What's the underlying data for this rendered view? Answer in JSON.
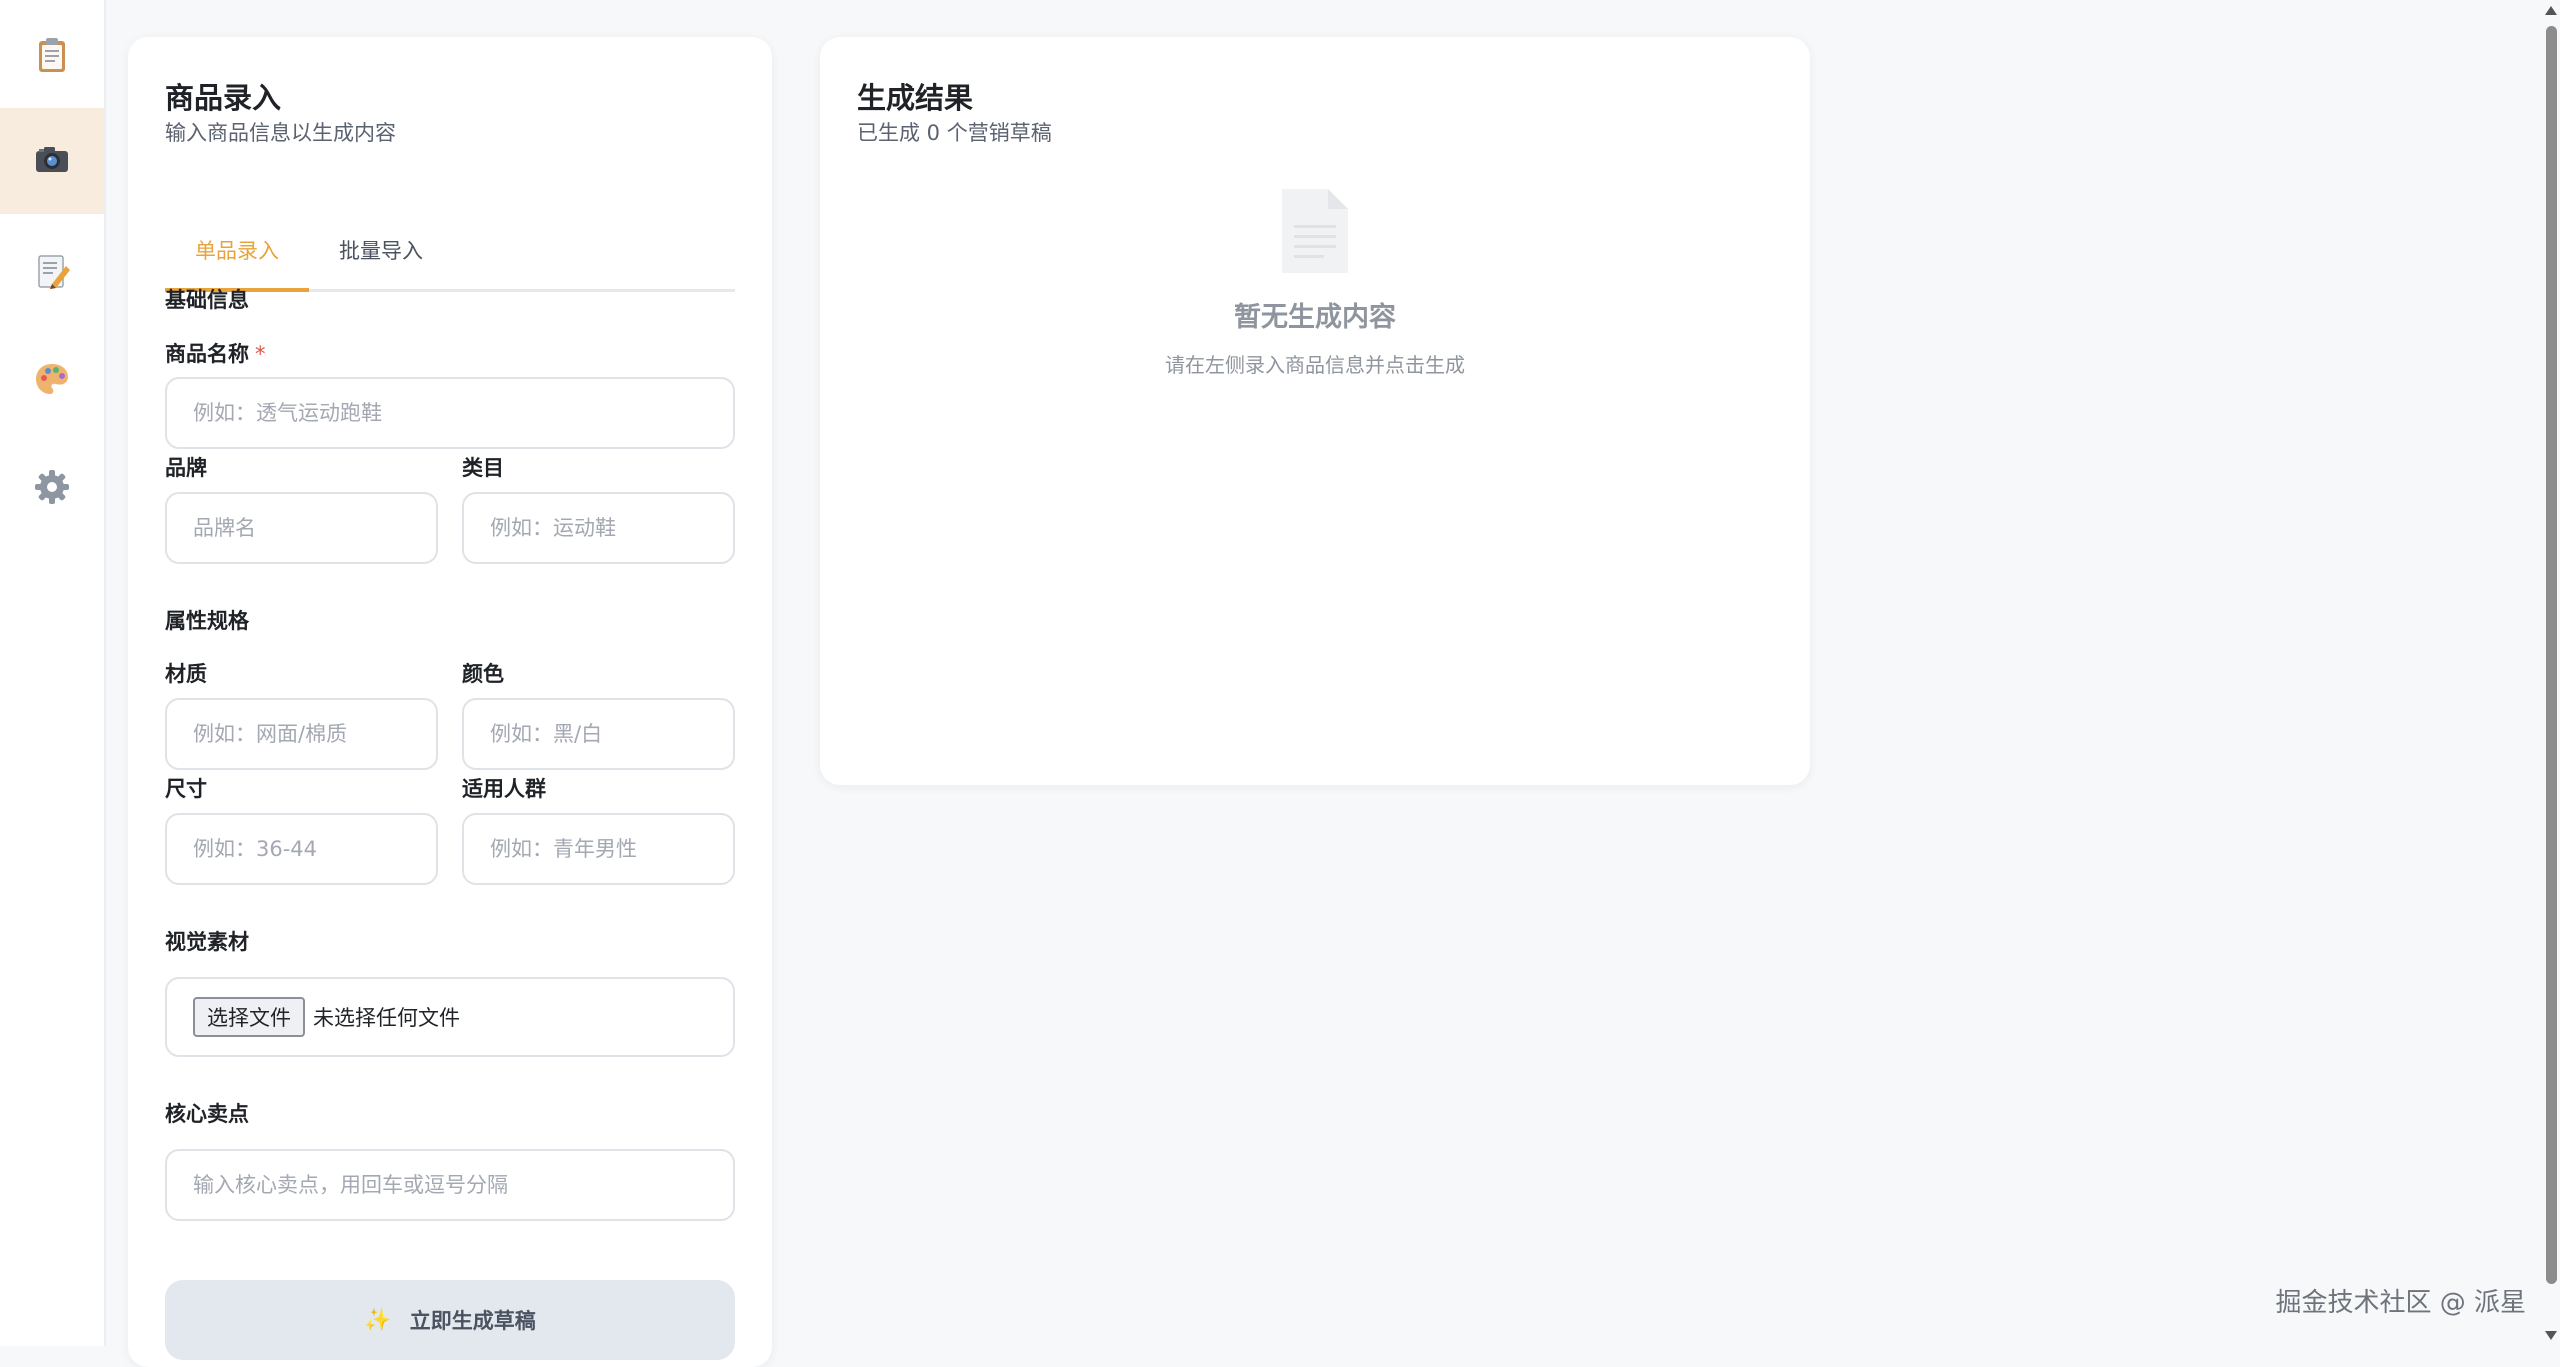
{
  "sidebar": {
    "items": [
      {
        "icon": "clipboard-icon",
        "active": false
      },
      {
        "icon": "camera-icon",
        "active": true
      },
      {
        "icon": "memo-icon",
        "active": false
      },
      {
        "icon": "palette-icon",
        "active": false
      },
      {
        "icon": "gear-icon",
        "active": false
      }
    ]
  },
  "left": {
    "title": "商品录入",
    "subtitle": "输入商品信息以生成内容",
    "tabs": [
      "单品录入",
      "批量导入"
    ],
    "section_basic": "基础信息",
    "section_attrs": "属性规格",
    "section_visual": "视觉素材",
    "section_selling": "核心卖点",
    "fields": {
      "name": {
        "label": "商品名称",
        "required": "*",
        "placeholder": "例如：透气运动跑鞋",
        "value": ""
      },
      "brand": {
        "label": "品牌",
        "placeholder": "品牌名",
        "value": ""
      },
      "category": {
        "label": "类目",
        "placeholder": "例如：运动鞋",
        "value": ""
      },
      "material": {
        "label": "材质",
        "placeholder": "例如：网面/棉质",
        "value": ""
      },
      "color": {
        "label": "颜色",
        "placeholder": "例如：黑/白",
        "value": ""
      },
      "size": {
        "label": "尺寸",
        "placeholder": "例如：36-44",
        "value": ""
      },
      "audience": {
        "label": "适用人群",
        "placeholder": "例如：青年男性",
        "value": ""
      },
      "selling": {
        "placeholder": "输入核心卖点，用回车或逗号分隔",
        "value": ""
      }
    },
    "file": {
      "button": "选择文件",
      "status": "未选择任何文件"
    },
    "generate_button": "立即生成草稿"
  },
  "right": {
    "title": "生成结果",
    "subtitle": "已生成 0 个营销草稿",
    "empty_title": "暂无生成内容",
    "empty_hint": "请在左侧录入商品信息并点击生成"
  },
  "watermark": "掘金技术社区 @ 派星",
  "colors": {
    "accent": "#e8a33c",
    "active_bg": "#f8ecdf",
    "required": "#e0534a"
  }
}
